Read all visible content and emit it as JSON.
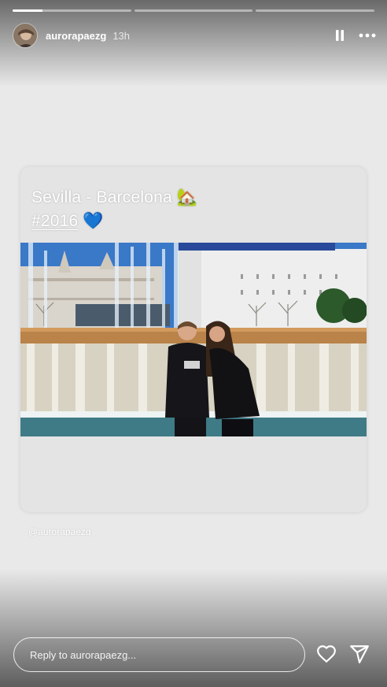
{
  "story": {
    "progress_segments": [
      {
        "progress": 0.25
      },
      {
        "progress": 0
      },
      {
        "progress": 0
      }
    ],
    "user": {
      "username": "aurorapaezg",
      "time_ago": "13h"
    },
    "header_icons": {
      "pause": "pause-icon",
      "more": "more-options-icon"
    }
  },
  "card": {
    "caption_line1": "Sevilla - Barcelona",
    "caption_line1_emoji": "🏡",
    "caption_line2": "#2016",
    "caption_line2_emoji": "💙",
    "photo_icon": "photo"
  },
  "mention": "@aurorapaezg",
  "footer": {
    "reply_placeholder": "Reply to aurorapaezg...",
    "like_icon": "heart-icon",
    "share_icon": "send-icon"
  },
  "colors": {
    "background": "#e9e9e9",
    "card": "#e4e4e4",
    "text": "#ffffff"
  }
}
